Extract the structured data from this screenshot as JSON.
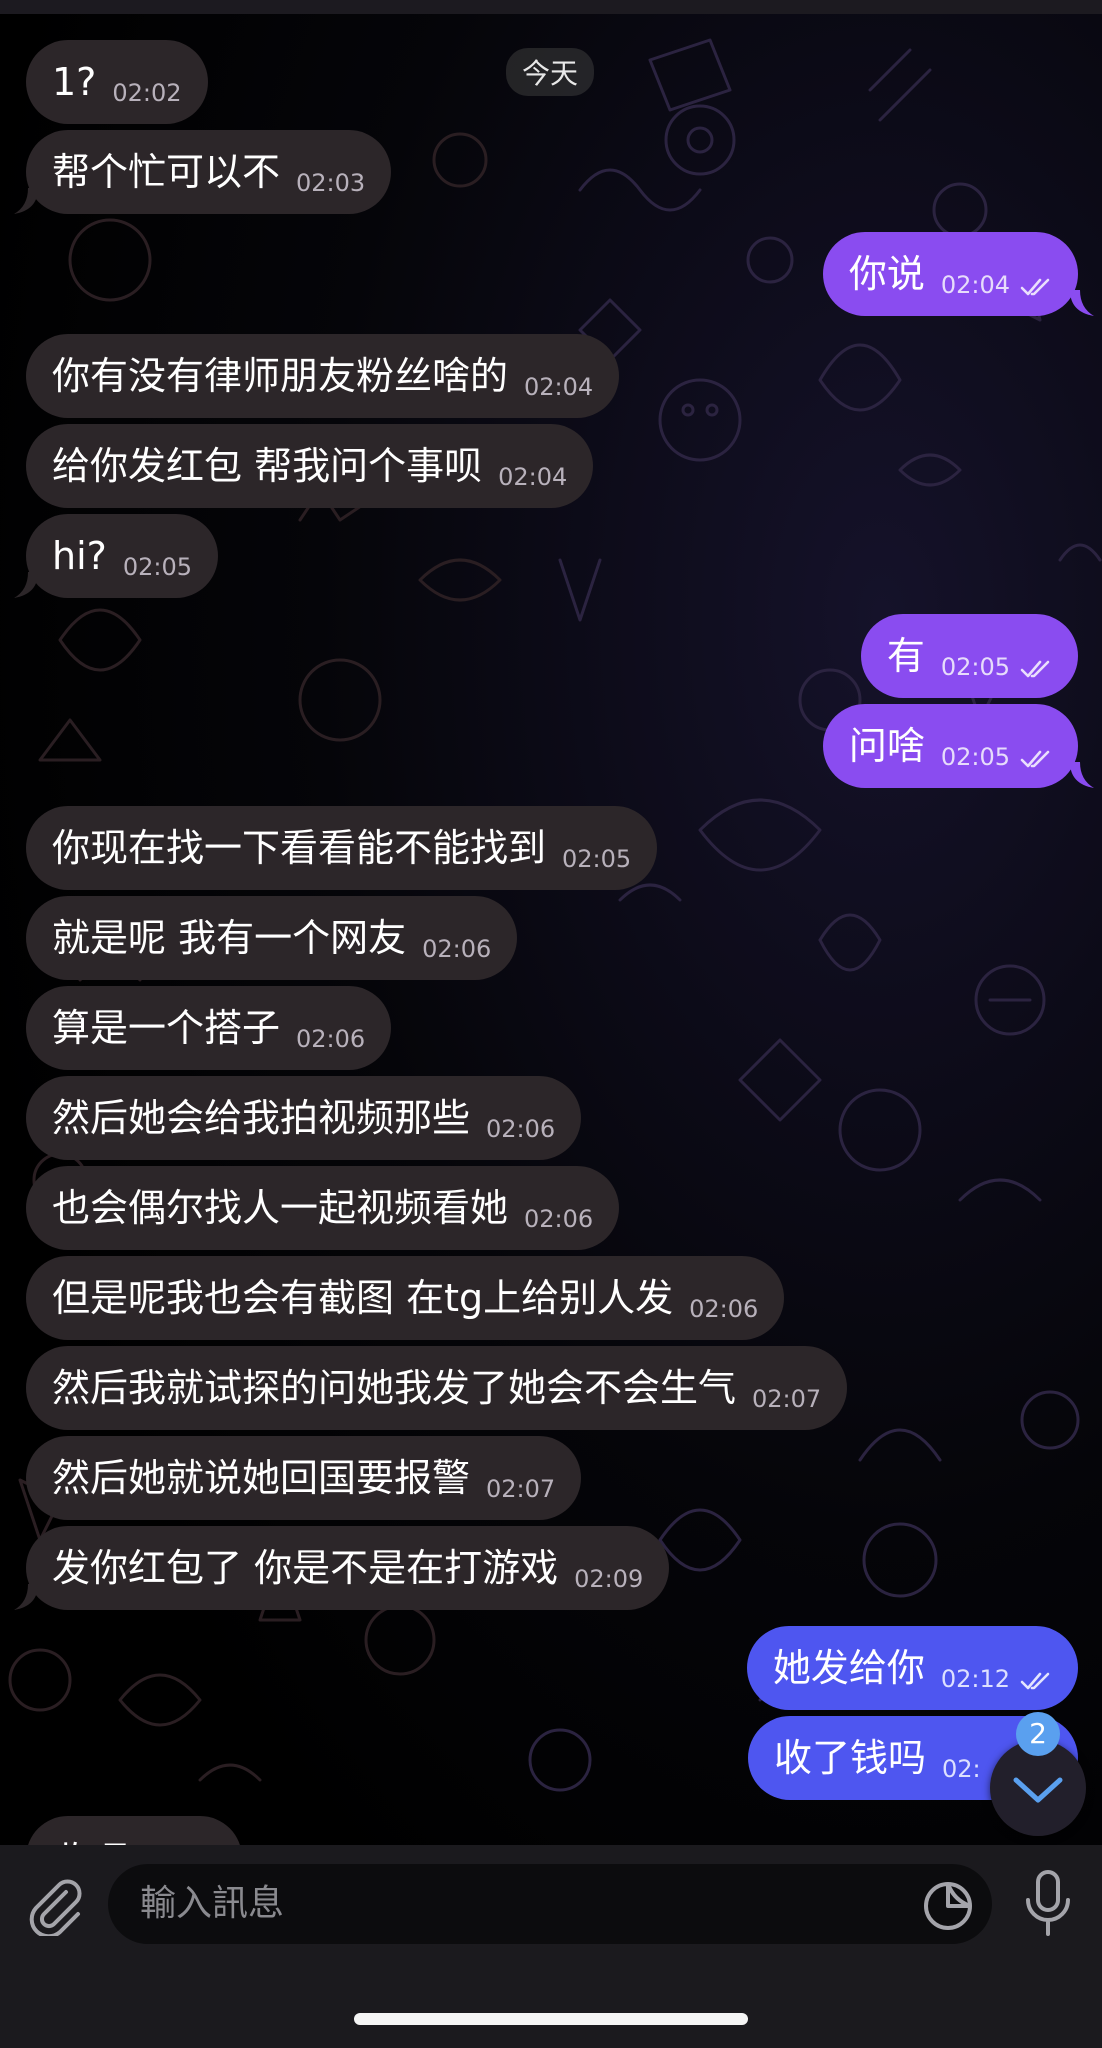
{
  "chat": {
    "date_separator": "今天",
    "messages": [
      {
        "dir": "in",
        "text": "1?",
        "time": "02:02"
      },
      {
        "dir": "in",
        "text": "帮个忙可以不",
        "time": "02:03"
      },
      {
        "dir": "out",
        "text": "你说",
        "time": "02:04"
      },
      {
        "dir": "in",
        "text": "你有没有律师朋友粉丝啥的",
        "time": "02:04"
      },
      {
        "dir": "in",
        "text": "给你发红包 帮我问个事呗",
        "time": "02:04"
      },
      {
        "dir": "in",
        "text": "hi?",
        "time": "02:05"
      },
      {
        "dir": "out",
        "text": "有",
        "time": "02:05"
      },
      {
        "dir": "out",
        "text": "问啥",
        "time": "02:05"
      },
      {
        "dir": "in",
        "text": "你现在找一下看看能不能找到",
        "time": "02:05"
      },
      {
        "dir": "in",
        "text": "就是呢 我有一个网友",
        "time": "02:06"
      },
      {
        "dir": "in",
        "text": "算是一个搭子",
        "time": "02:06"
      },
      {
        "dir": "in",
        "text": "然后她会给我拍视频那些",
        "time": "02:06"
      },
      {
        "dir": "in",
        "text": "也会偶尔找人一起视频看她",
        "time": "02:06"
      },
      {
        "dir": "in",
        "text": "但是呢我也会有截图 在tg上给别人发",
        "time": "02:06"
      },
      {
        "dir": "in",
        "text": "然后我就试探的问她我发了她会不会生气",
        "time": "02:07"
      },
      {
        "dir": "in",
        "text": "然后她就说她回国要报警",
        "time": "02:07"
      },
      {
        "dir": "in",
        "text": "发你红包了 你是不是在打游戏",
        "time": "02:09"
      },
      {
        "dir": "out",
        "text": "她发给你",
        "time": "02:12"
      },
      {
        "dir": "out",
        "text": "收了钱吗",
        "time": "02:"
      }
    ],
    "partial_message": "收呀",
    "unread_count": "2"
  },
  "composer": {
    "placeholder": "輸入訊息"
  },
  "colors": {
    "incoming_bubble": "#2c2629",
    "outgoing_bubble_purple": "#8a4cf0",
    "outgoing_bubble_blue": "#4e56f0",
    "badge": "#5aa0ef"
  },
  "icons": {
    "attach": "paperclip-icon",
    "sticker": "sticker-icon",
    "voice": "microphone-icon",
    "read_receipt": "double-check-icon",
    "scroll_down": "chevron-down-icon"
  }
}
